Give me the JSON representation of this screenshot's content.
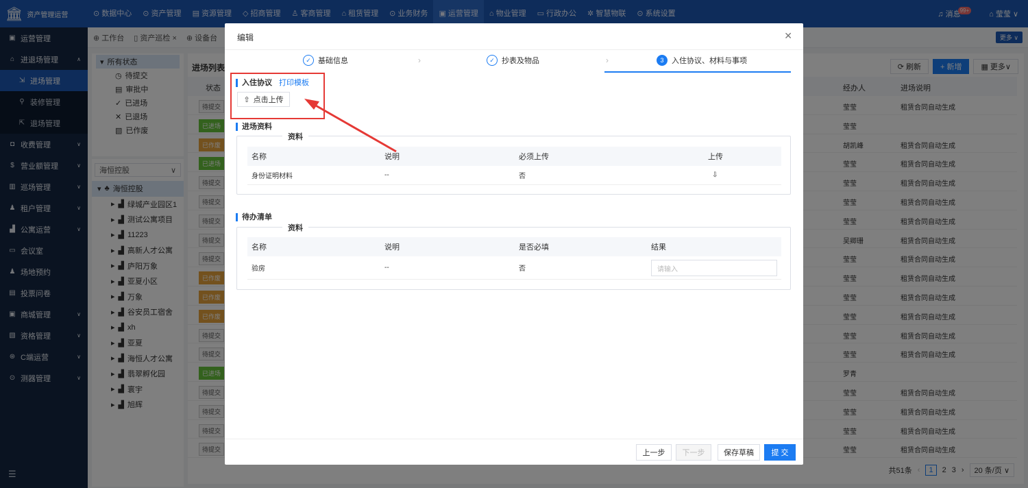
{
  "app": {
    "title": "资产管理运营"
  },
  "topnav": [
    {
      "label": "⊙ 数据中心"
    },
    {
      "label": "⊙ 资产管理"
    },
    {
      "label": "▤ 资源管理"
    },
    {
      "label": "◇ 招商管理"
    },
    {
      "label": "♙ 客商管理"
    },
    {
      "label": "⌂ 租赁管理"
    },
    {
      "label": "⊙ 业务财务"
    },
    {
      "label": "▣ 运营管理"
    },
    {
      "label": "⌂ 物业管理"
    },
    {
      "label": "▭ 行政办公"
    },
    {
      "label": "✲ 智慧物联"
    },
    {
      "label": "⊙ 系统设置"
    }
  ],
  "topright": {
    "messages": "消息",
    "badge": "99+",
    "user": "莹莹"
  },
  "sidebar": [
    {
      "label": "运营管理",
      "icon": "▣"
    },
    {
      "label": "进退场管理",
      "icon": "⌂"
    },
    {
      "label": "进场管理",
      "icon": "⇲"
    },
    {
      "label": "装修管理",
      "icon": "⚲"
    },
    {
      "label": "退场管理",
      "icon": "⇱"
    },
    {
      "label": "收费管理",
      "icon": "◘"
    },
    {
      "label": "营业额管理",
      "icon": "$"
    },
    {
      "label": "巡场管理",
      "icon": "▥"
    },
    {
      "label": "租户管理",
      "icon": "♟"
    },
    {
      "label": "公寓运营",
      "icon": "▟"
    },
    {
      "label": "会议室",
      "icon": "▭"
    },
    {
      "label": "场地预约",
      "icon": "♟"
    },
    {
      "label": "投票问卷",
      "icon": "▤"
    },
    {
      "label": "商城管理",
      "icon": "▣"
    },
    {
      "label": "资格管理",
      "icon": "▧"
    },
    {
      "label": "C端运营",
      "icon": "⊛"
    },
    {
      "label": "测器管理",
      "icon": "⊙"
    }
  ],
  "tabs": [
    {
      "label": "⊕ 工作台"
    },
    {
      "label": "▯ 资产巡检 ×"
    },
    {
      "label": "⊕ 设备台"
    }
  ],
  "tabbar_more": "更多 ∨",
  "status_tree": {
    "root": "所有状态",
    "items": [
      {
        "icon": "◷",
        "label": "待提交"
      },
      {
        "icon": "▤",
        "label": "审批中"
      },
      {
        "icon": "✓",
        "label": "已进场"
      },
      {
        "icon": "✕",
        "label": "已退场"
      },
      {
        "icon": "▧",
        "label": "已作废"
      }
    ]
  },
  "org": {
    "select": "海恒控股",
    "root": "海恒控股",
    "items": [
      "绿城产业园区1",
      "测试公寓项目",
      "11223",
      "高新人才公寓",
      "庐阳万象",
      "亚夏小区",
      "万象",
      "谷安员工宿舍",
      "xh",
      "亚夏",
      "海恒人才公寓",
      "翡翠孵化园",
      "寰宇",
      "旭辉"
    ]
  },
  "list": {
    "title": "进场列表",
    "col_status": "状态",
    "col_agent": "经办人",
    "col_desc": "进场说明",
    "refresh": "⟳ 刷新",
    "add": "+ 新增",
    "more": "▦ 更多∨",
    "rows": [
      {
        "status": "待提交",
        "type": "pending",
        "agent": "莹莹",
        "desc": "租赁合同自动生成"
      },
      {
        "status": "已进场",
        "type": "in",
        "agent": "莹莹",
        "desc": ""
      },
      {
        "status": "已作废",
        "type": "void",
        "agent": "胡凯峰",
        "desc": "租赁合同自动生成"
      },
      {
        "status": "已进场",
        "type": "in",
        "agent": "莹莹",
        "desc": "租赁合同自动生成"
      },
      {
        "status": "待提交",
        "type": "pending",
        "agent": "莹莹",
        "desc": "租赁合同自动生成"
      },
      {
        "status": "待提交",
        "type": "pending",
        "agent": "莹莹",
        "desc": "租赁合同自动生成"
      },
      {
        "status": "待提交",
        "type": "pending",
        "agent": "莹莹",
        "desc": "租赁合同自动生成"
      },
      {
        "status": "待提交",
        "type": "pending",
        "agent": "吴卿珊",
        "desc": "租赁合同自动生成"
      },
      {
        "status": "待提交",
        "type": "pending",
        "agent": "莹莹",
        "desc": "租赁合同自动生成"
      },
      {
        "status": "已作废",
        "type": "void",
        "agent": "莹莹",
        "desc": "租赁合同自动生成"
      },
      {
        "status": "已作废",
        "type": "void",
        "agent": "莹莹",
        "desc": "租赁合同自动生成"
      },
      {
        "status": "已作废",
        "type": "void",
        "agent": "莹莹",
        "desc": "租赁合同自动生成"
      },
      {
        "status": "待提交",
        "type": "pending",
        "agent": "莹莹",
        "desc": "租赁合同自动生成"
      },
      {
        "status": "待提交",
        "type": "pending",
        "agent": "莹莹",
        "desc": "租赁合同自动生成"
      },
      {
        "status": "已进场",
        "type": "in",
        "agent": "罗青",
        "desc": ""
      },
      {
        "status": "待提交",
        "type": "pending",
        "agent": "莹莹",
        "desc": "租赁合同自动生成"
      },
      {
        "status": "待提交",
        "type": "pending",
        "agent": "莹莹",
        "desc": "租赁合同自动生成"
      },
      {
        "status": "待提交",
        "type": "pending",
        "agent": "莹莹",
        "desc": "租赁合同自动生成"
      },
      {
        "status": "待提交",
        "type": "pending",
        "agent": "莹莹",
        "desc": "租赁合同自动生成"
      }
    ],
    "pager": {
      "total": "共51条",
      "pages": [
        "1",
        "2",
        "3"
      ],
      "size": "20 条/页"
    }
  },
  "modal": {
    "title": "编辑",
    "steps": [
      {
        "label": "基础信息",
        "mark": "✓"
      },
      {
        "label": "抄表及物品",
        "mark": "✓"
      },
      {
        "label": "入住协议、材料与事项",
        "mark": "3"
      }
    ],
    "agreement": {
      "title": "入住协议",
      "link": "打印模板",
      "upload": "点击上传"
    },
    "entry_materials": {
      "title": "进场资料",
      "legend": "资料",
      "headers": [
        "名称",
        "说明",
        "必须上传",
        "上传"
      ],
      "row": {
        "name": "身份证明材料",
        "desc": "--",
        "required": "否"
      }
    },
    "todo": {
      "title": "待办清单",
      "legend": "资料",
      "headers": [
        "名称",
        "说明",
        "是否必填",
        "结果"
      ],
      "row": {
        "name": "验房",
        "desc": "--",
        "required": "否",
        "placeholder": "请输入"
      }
    },
    "footer": {
      "prev": "上一步",
      "next": "下一步",
      "draft": "保存草稿",
      "submit": "提 交"
    }
  },
  "colors": {
    "brand": "#1c58b5",
    "accent": "#1c7cf2",
    "annotation": "#e53935"
  }
}
